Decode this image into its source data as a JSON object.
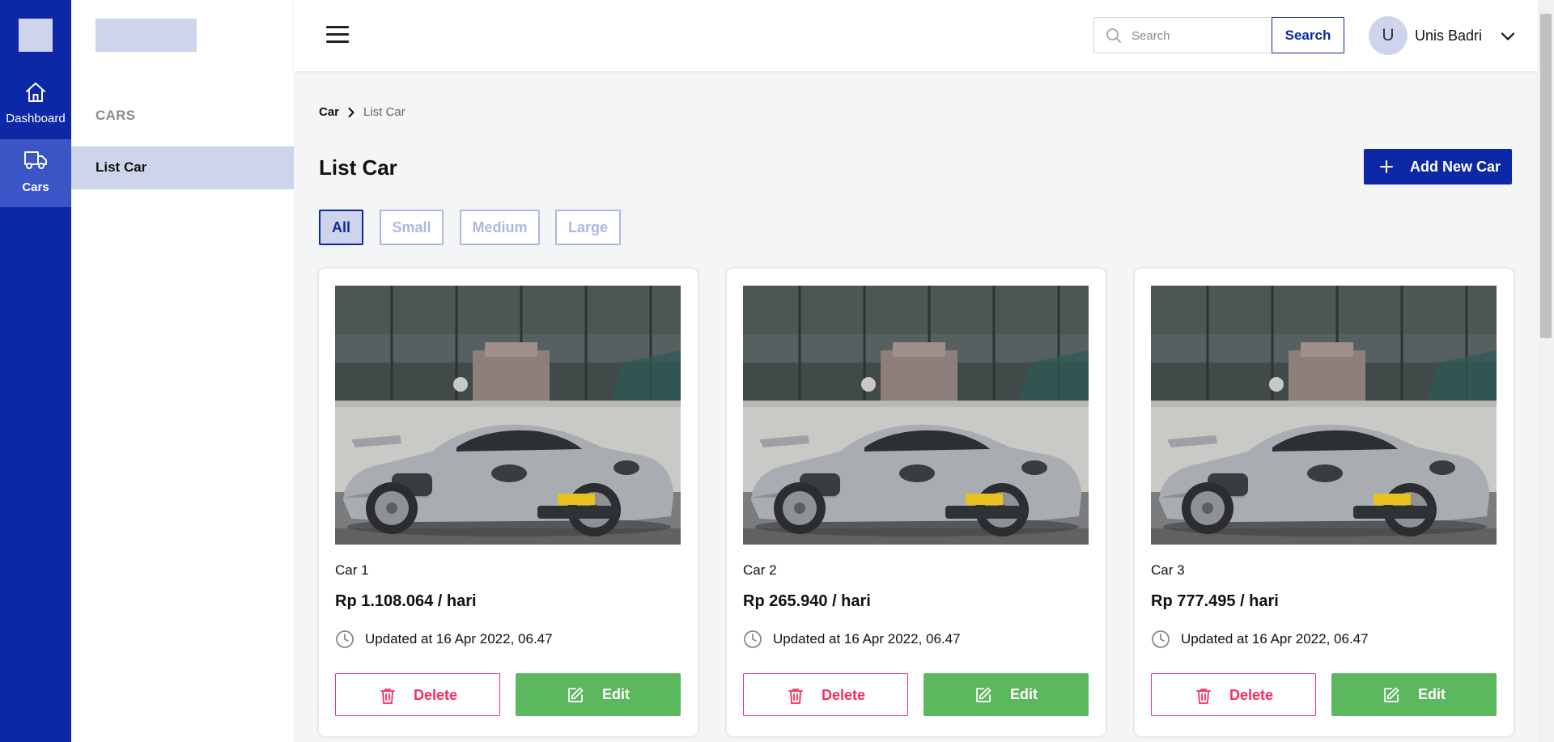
{
  "rail": {
    "items": [
      {
        "label": "Dashboard",
        "icon": "home-icon"
      },
      {
        "label": "Cars",
        "icon": "truck-icon"
      }
    ]
  },
  "sidebar": {
    "section_title": "CARS",
    "items": [
      {
        "label": "List Car"
      }
    ]
  },
  "header": {
    "search_placeholder": "Search",
    "search_button": "Search",
    "avatar_initial": "U",
    "user_name": "Unis Badri"
  },
  "breadcrumb": {
    "root": "Car",
    "current": "List Car"
  },
  "page": {
    "title": "List Car",
    "add_button": "Add New Car"
  },
  "filters": {
    "items": [
      "All",
      "Small",
      "Medium",
      "Large"
    ],
    "selected": "All"
  },
  "cars": [
    {
      "name": "Car 1",
      "price": "Rp 1.108.064 / hari",
      "updated": "Updated at 16 Apr 2022, 06.47",
      "delete_label": "Delete",
      "edit_label": "Edit"
    },
    {
      "name": "Car 2",
      "price": "Rp 265.940 / hari",
      "updated": "Updated at 16 Apr 2022, 06.47",
      "delete_label": "Delete",
      "edit_label": "Edit"
    },
    {
      "name": "Car 3",
      "price": "Rp 777.495 / hari",
      "updated": "Updated at 16 Apr 2022, 06.47",
      "delete_label": "Delete",
      "edit_label": "Edit"
    }
  ],
  "colors": {
    "primary": "#0D28A6",
    "primary_light": "#CFD4ED",
    "danger": "#FA2C5A",
    "success": "#5CB85F",
    "background": "#F4F5F7"
  }
}
